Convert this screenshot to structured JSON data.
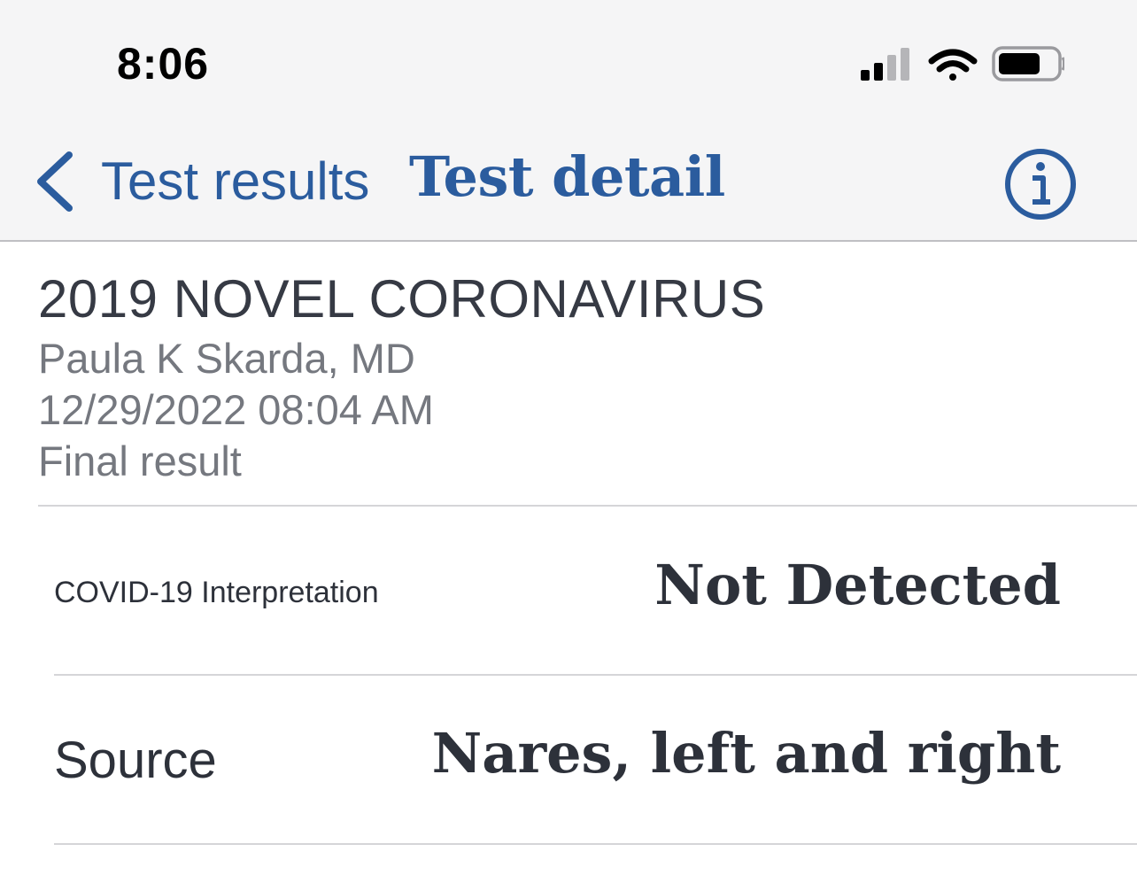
{
  "status_bar": {
    "time": "8:06",
    "icons": [
      "cellular-signal-icon",
      "wifi-icon",
      "battery-icon"
    ]
  },
  "nav": {
    "back_label": "Test results",
    "title": "Test detail",
    "info_icon": "info-icon"
  },
  "test": {
    "name": "2019 NOVEL CORONAVIRUS",
    "provider": "Paula K Skarda, MD",
    "datetime": "12/29/2022 08:04 AM",
    "status": "Final result"
  },
  "results": [
    {
      "label": "COVID-19 Interpretation",
      "value": "Not Detected"
    },
    {
      "label": "Source",
      "value": "Nares, left and right"
    }
  ],
  "colors": {
    "accent": "#2b5c9e",
    "text_dark": "#2d313a",
    "text_muted": "#75787f",
    "bar_background": "#f5f5f6"
  }
}
